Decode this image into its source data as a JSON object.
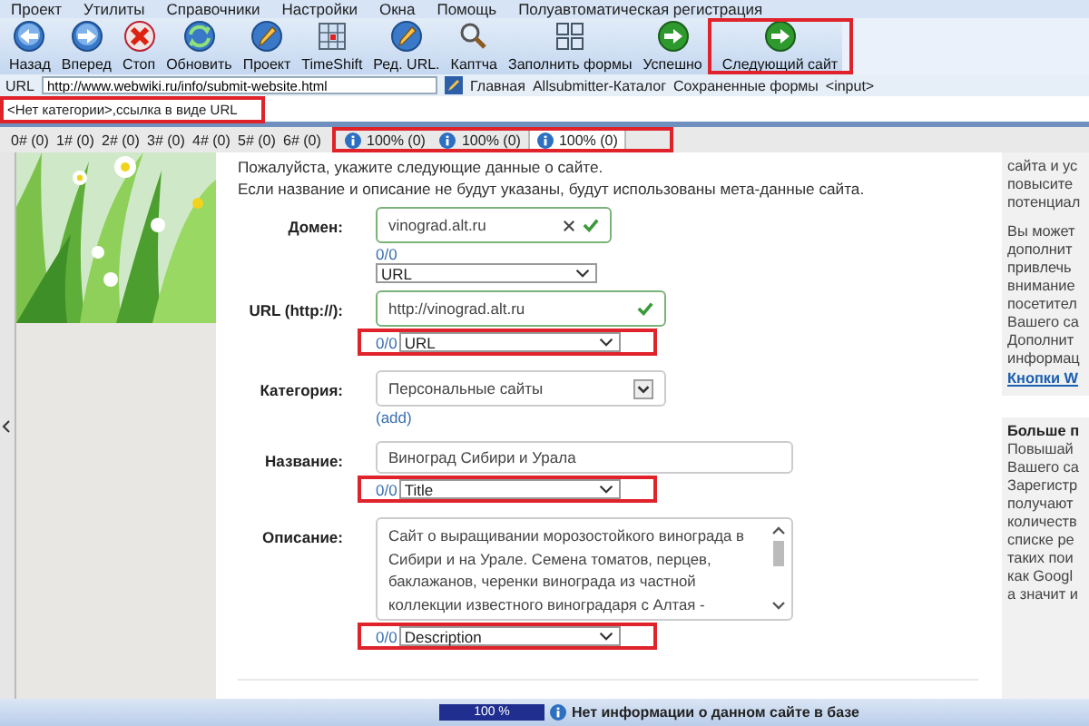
{
  "menu": [
    "Проект",
    "Утилиты",
    "Справочники",
    "Настройки",
    "Окна",
    "Помощь",
    "Полуавтоматическая регистрация"
  ],
  "toolbar": [
    {
      "label": "Назад",
      "kind": "back",
      "highlighted": false
    },
    {
      "label": "Вперед",
      "kind": "forward",
      "highlighted": false
    },
    {
      "label": "Стоп",
      "kind": "stop",
      "highlighted": false
    },
    {
      "label": "Обновить",
      "kind": "refresh",
      "highlighted": false
    },
    {
      "label": "Проект",
      "kind": "project",
      "highlighted": false
    },
    {
      "label": "TimeShift",
      "kind": "timeshift",
      "highlighted": false
    },
    {
      "label": "Ред. URL.",
      "kind": "edit",
      "highlighted": false
    },
    {
      "label": "Каптча",
      "kind": "captcha",
      "highlighted": false
    },
    {
      "label": "Заполнить формы",
      "kind": "forms",
      "highlighted": false
    },
    {
      "label": "Успешно",
      "kind": "go",
      "highlighted": false
    },
    {
      "label": "Следующий сайт",
      "kind": "go",
      "highlighted": true
    }
  ],
  "address_bar": {
    "label": "URL",
    "value": "http://www.webwiki.ru/info/submit-website.html",
    "links": [
      "Главная",
      "Allsubmitter-Каталог",
      "Сохраненные формы",
      "<input>"
    ]
  },
  "category_field": {
    "value": "<Нет категории>,ссылка в виде URL",
    "highlighted": true
  },
  "site_tabs": [
    {
      "label": "0# (0)"
    },
    {
      "label": "1# (0)"
    },
    {
      "label": "2# (0)"
    },
    {
      "label": "3# (0)"
    },
    {
      "label": "4# (0)"
    },
    {
      "label": "5# (0)"
    },
    {
      "label": "6# (0)"
    }
  ],
  "progress_tabs": {
    "highlighted": true,
    "items": [
      {
        "label": "100% (0)",
        "selected": false
      },
      {
        "label": "100% (0)",
        "selected": false
      },
      {
        "label": "100% (0)",
        "selected": true
      }
    ]
  },
  "intro": [
    "Пожалуйста, укажите следующие данные о сайте.",
    "Если название и описание не будут указаны, будут использованы мета-данные сайта."
  ],
  "fields": [
    {
      "kind": "input",
      "label": "Домен:",
      "value": "vinograd.alt.ru",
      "clearable": true,
      "valid": true,
      "counter": "0/0",
      "mapping": "URL",
      "counter_inline": false,
      "highlighted": false
    },
    {
      "kind": "input",
      "label": "URL (http://):",
      "value": "http://vinograd.alt.ru",
      "clearable": false,
      "valid": true,
      "counter": "0/0",
      "mapping": "URL",
      "counter_inline": true,
      "highlighted": true
    },
    {
      "kind": "select",
      "label": "Категория:",
      "value": "Персональные сайты",
      "link": "(add)"
    },
    {
      "kind": "wide",
      "label": "Название:",
      "value": "Виноград Сибири и Урала",
      "counter": "0/0",
      "mapping": "Title",
      "counter_inline": true,
      "highlighted": true
    },
    {
      "kind": "textarea",
      "label": "Описание:",
      "lines": [
        "Сайт о выращивании морозостойкого винограда в",
        "Сибири и на Урале. Семена томатов, перцев,",
        "баклажанов, черенки винограда из частной",
        "коллекции известного виноградаря с Алтая -"
      ],
      "counter": "0/0",
      "mapping": "Description",
      "counter_inline": true,
      "highlighted": true
    }
  ],
  "right_panel": [
    {
      "lines": [
        "сайта и ус",
        "повысите",
        "потенциал"
      ],
      "lines2": [
        "Вы может",
        "дополнит",
        "привлечь",
        "внимание",
        "посетител",
        "Вашего са",
        "Дополнит",
        "информац"
      ],
      "link": "Кнопки W"
    },
    {
      "title": "Больше п",
      "lines": [
        "Повышай",
        "Вашего са",
        "Зарегистр",
        "получают",
        "количеств",
        "списке ре",
        "таких пои",
        "как Googl",
        "а значит и"
      ]
    }
  ],
  "status_bar": {
    "progress": {
      "level": 1,
      "label": "100 %"
    },
    "message": "Нет информации о данном сайте в базе"
  }
}
